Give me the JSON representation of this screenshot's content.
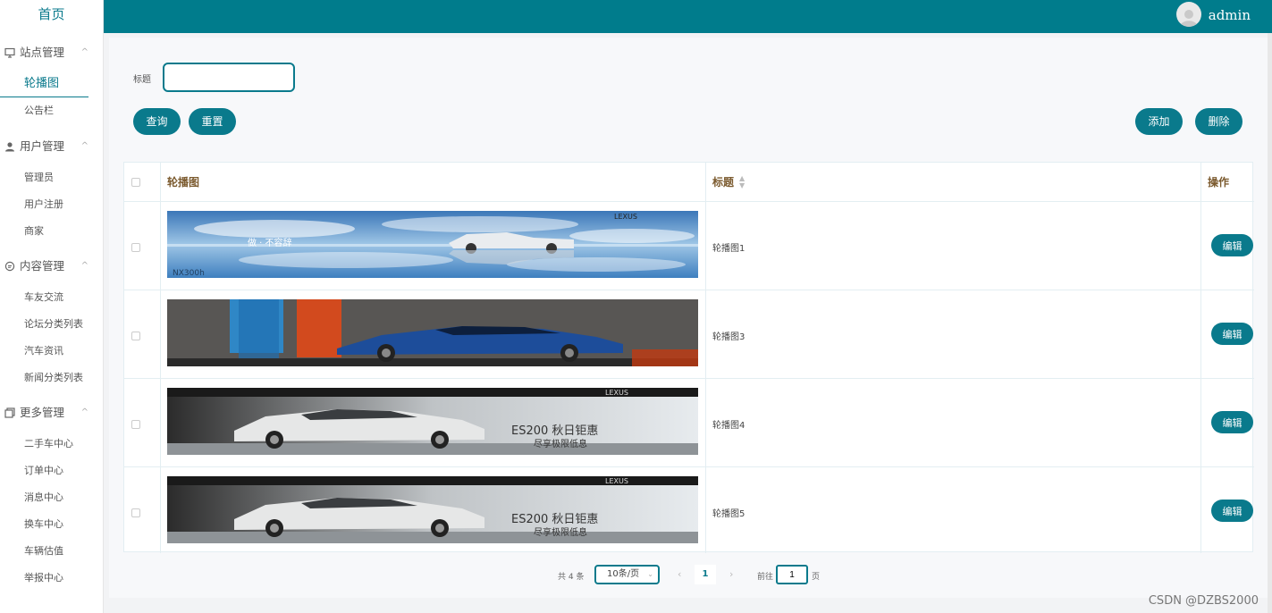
{
  "sidebar": {
    "home": "首页",
    "groups": [
      {
        "label": "站点管理",
        "icon": "monitor-icon",
        "items": [
          "轮播图",
          "公告栏"
        ]
      },
      {
        "label": "用户管理",
        "icon": "user-icon",
        "items": [
          "管理员",
          "用户注册",
          "商家"
        ]
      },
      {
        "label": "内容管理",
        "icon": "chat-icon",
        "items": [
          "车友交流",
          "论坛分类列表",
          "汽车资讯",
          "新闻分类列表"
        ]
      },
      {
        "label": "更多管理",
        "icon": "copy-icon",
        "items": [
          "二手车中心",
          "订单中心",
          "消息中心",
          "换车中心",
          "车辆估值",
          "举报中心"
        ]
      }
    ],
    "active_item": "轮播图"
  },
  "header": {
    "username": "admin"
  },
  "search": {
    "label": "标题",
    "value": "",
    "query_label": "查询",
    "reset_label": "重置"
  },
  "toolbar": {
    "add_label": "添加",
    "delete_label": "删除"
  },
  "table": {
    "columns": [
      "轮播图",
      "标题",
      "操作"
    ],
    "rows": [
      {
        "title": "轮播图1",
        "edit_label": "编辑",
        "banner": {
          "theme": "sky",
          "brand": "LEXUS",
          "text": "做 · 不容辞",
          "subtext": "NX300h"
        }
      },
      {
        "title": "轮播图3",
        "edit_label": "编辑",
        "banner": {
          "theme": "wall",
          "brand": "",
          "text": "",
          "subtext": ""
        }
      },
      {
        "title": "轮播图4",
        "edit_label": "编辑",
        "banner": {
          "theme": "garage",
          "brand": "LEXUS",
          "text": "ES200 秋日钜惠",
          "subtext": "尽享极限低息"
        }
      },
      {
        "title": "轮播图5",
        "edit_label": "编辑",
        "banner": {
          "theme": "garage",
          "brand": "LEXUS",
          "text": "ES200 秋日钜惠",
          "subtext": "尽享极限低息"
        }
      }
    ]
  },
  "pagination": {
    "total": "共 4 条",
    "page_size": "10条/页",
    "current_page": "1",
    "goto_label": "前往",
    "goto_value": "1",
    "goto_unit": "页"
  },
  "watermark": "CSDN @DZBS2000",
  "colors": {
    "accent": "#007c8c",
    "header_text": "#7b5a2e"
  }
}
